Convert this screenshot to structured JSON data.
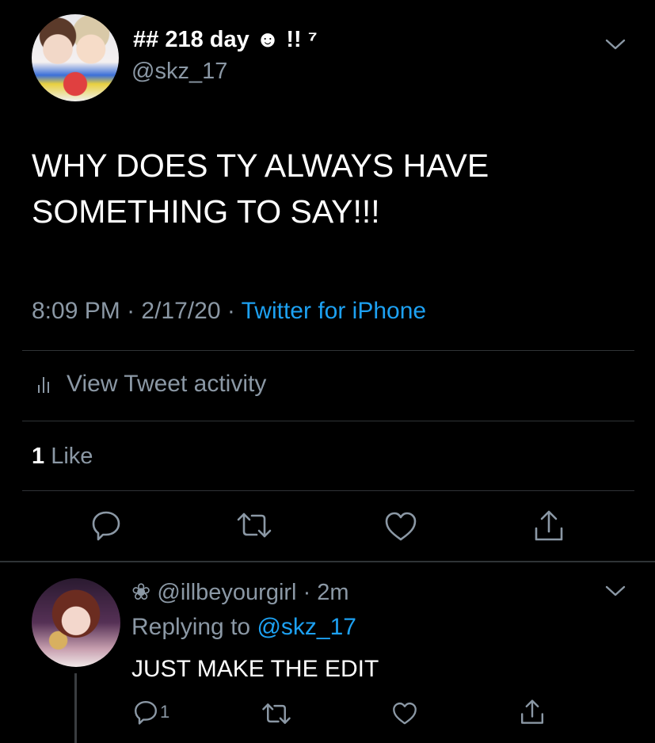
{
  "tweet": {
    "display_name": "## 218 day ☻ !! ⁷",
    "handle": "@skz_17",
    "text_line1": "WHY DOES TY ALWAYS HAVE",
    "text_line2": "SOMETHING TO SAY!!!",
    "time": "8:09 PM",
    "date": "2/17/20",
    "source": "Twitter for iPhone",
    "activity_label": "View Tweet activity",
    "like_count": "1",
    "like_label": "Like"
  },
  "reply": {
    "name_prefix": "❀",
    "handle": "@illbeyourgirl",
    "time": "2m",
    "replying_prefix": "Replying to",
    "replying_to": "@skz_17",
    "text": "JUST MAKE THE EDIT",
    "reply_count": "1"
  },
  "colors": {
    "background": "#000000",
    "secondary_text": "#8b98a5",
    "accent": "#1da1f2",
    "divider": "#2f3336"
  },
  "icons": [
    "chevron-down-icon",
    "stats-icon",
    "reply-icon",
    "retweet-icon",
    "like-icon",
    "share-icon"
  ]
}
